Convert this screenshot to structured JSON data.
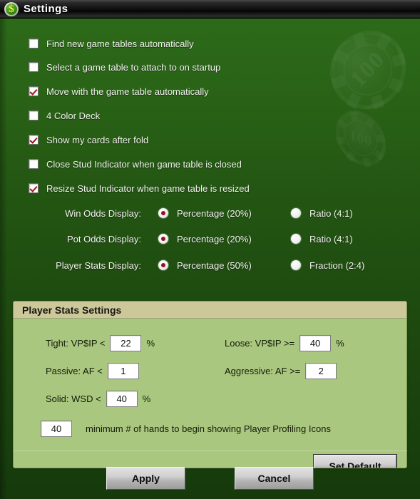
{
  "window": {
    "title": "Settings",
    "icon": "dollar-chip-icon",
    "accent_green": "#2c6a19",
    "checkmark_color": "#9a1621",
    "panel_body_color": "#aac77f",
    "panel_header_color": "#cdc89a"
  },
  "checkboxes": [
    {
      "label": "Find new game tables automatically",
      "checked": false
    },
    {
      "label": "Select a game table to attach to on startup",
      "checked": false
    },
    {
      "label": "Move with the game table automatically",
      "checked": true
    },
    {
      "label": "4 Color Deck",
      "checked": false
    },
    {
      "label": "Show my cards after fold",
      "checked": true
    },
    {
      "label": "Close Stud Indicator when game table is closed",
      "checked": false
    },
    {
      "label": "Resize Stud Indicator when game table is resized",
      "checked": true
    }
  ],
  "radio_groups": [
    {
      "label": "Win Odds Display:",
      "options": [
        {
          "label": "Percentage (20%)",
          "selected": true
        },
        {
          "label": "Ratio (4:1)",
          "selected": false
        }
      ]
    },
    {
      "label": "Pot Odds Display:",
      "options": [
        {
          "label": "Percentage (20%)",
          "selected": true
        },
        {
          "label": "Ratio (4:1)",
          "selected": false
        }
      ]
    },
    {
      "label": "Player Stats Display:",
      "options": [
        {
          "label": "Percentage (50%)",
          "selected": true
        },
        {
          "label": "Fraction (2:4)",
          "selected": false
        }
      ]
    }
  ],
  "player_stats": {
    "title": "Player Stats Settings",
    "tight": {
      "label": "Tight:  VP$IP  <",
      "value": "22",
      "unit": "%"
    },
    "loose": {
      "label": "Loose:   VP$IP  >=",
      "value": "40",
      "unit": "%"
    },
    "passive": {
      "label": "Passive:  AF  <",
      "value": "1",
      "unit": ""
    },
    "aggressive": {
      "label": "Aggressive:  AF  >=",
      "value": "2",
      "unit": ""
    },
    "solid": {
      "label": "Solid:  WSD  <",
      "value": "40",
      "unit": "%"
    },
    "min_hands": {
      "value": "40",
      "label": "minimum # of hands to begin showing Player Profiling Icons"
    },
    "set_default_label": "Set Default"
  },
  "footer": {
    "apply_label": "Apply",
    "cancel_label": "Cancel"
  },
  "watermarks": {
    "chip_large_value": "100",
    "chip_small_value": "100"
  }
}
